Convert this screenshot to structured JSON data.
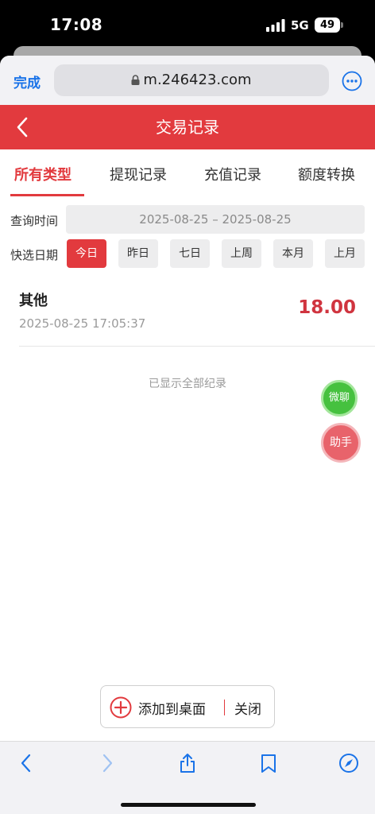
{
  "status_bar": {
    "time": "17:08",
    "network": "5G",
    "battery": "49"
  },
  "browser": {
    "done_label": "完成",
    "url": "m.246423.com"
  },
  "header": {
    "title": "交易记录"
  },
  "tabs": [
    {
      "label": "所有类型",
      "active": true
    },
    {
      "label": "提现记录",
      "active": false
    },
    {
      "label": "充值记录",
      "active": false
    },
    {
      "label": "额度转换",
      "active": false
    }
  ],
  "query": {
    "label": "查询时间",
    "range": "2025-08-25 – 2025-08-25"
  },
  "quick_dates": {
    "label": "快选日期",
    "options": [
      "今日",
      "昨日",
      "七日",
      "上周",
      "本月",
      "上月"
    ],
    "selected": "今日"
  },
  "records": [
    {
      "type": "其他",
      "time": "2025-08-25 17:05:37",
      "amount": "18.00"
    }
  ],
  "list_footer": "已显示全部纪录",
  "floating": {
    "wechat_label": "微聊",
    "help_label": "助手"
  },
  "add_to_home": {
    "add_label": "添加到桌面",
    "close_label": "关闭"
  },
  "colors": {
    "accent": "#e23a3e",
    "link": "#1a73e8",
    "wechat": "#46c13f",
    "help": "#e8636b"
  }
}
